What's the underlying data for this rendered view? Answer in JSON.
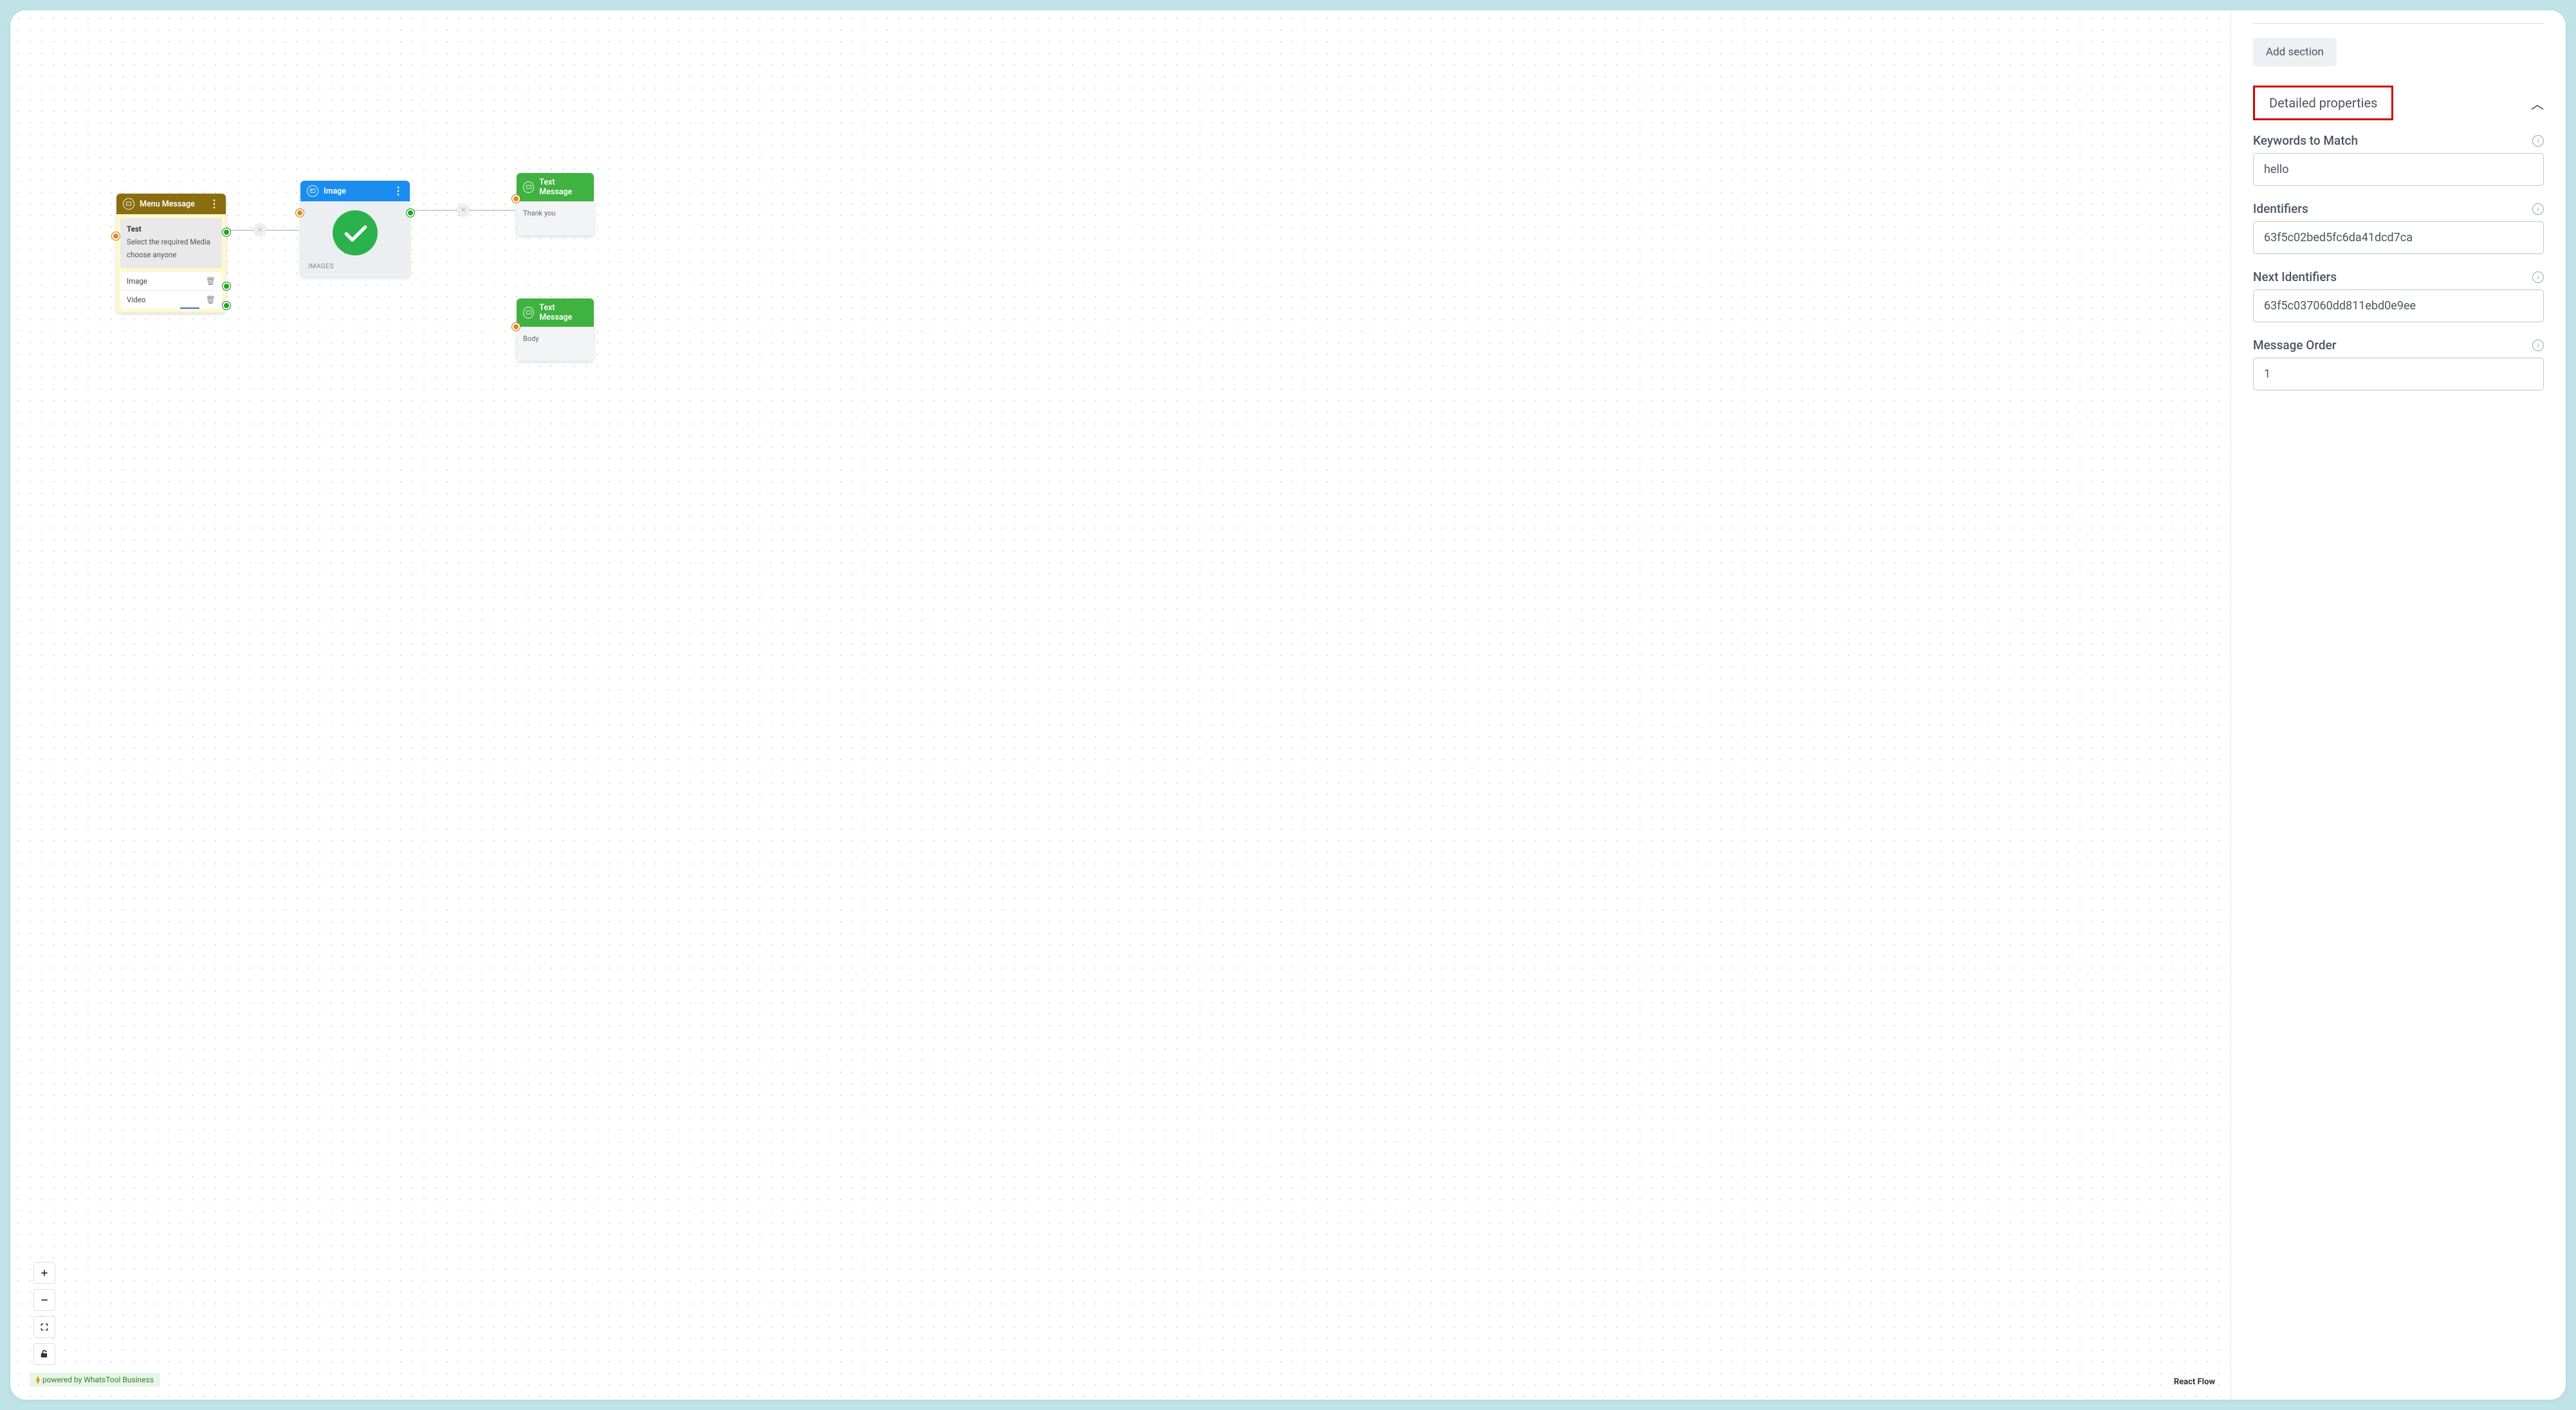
{
  "canvas": {
    "nodes": {
      "menu": {
        "title": "Menu Message",
        "body_title": "Test",
        "body_line1": "Select the required Media",
        "body_line2": "choose anyone",
        "options": [
          "Image",
          "Video"
        ]
      },
      "image": {
        "title": "Image",
        "caption": "IMAGES"
      },
      "text1": {
        "title": "Text Message",
        "body": "Thank you"
      },
      "text2": {
        "title": "Text Message",
        "body": "Body"
      }
    },
    "powered_by": "powered by WhatsTool Business",
    "react_flow": "React Flow"
  },
  "panel": {
    "add_section": "Add section",
    "detailed_properties": "Detailed properties",
    "fields": {
      "keywords": {
        "label": "Keywords to Match",
        "value": "hello"
      },
      "identifiers": {
        "label": "Identifiers",
        "value": "63f5c02bed5fc6da41dcd7ca"
      },
      "next_identifiers": {
        "label": "Next Identifiers",
        "value": "63f5c037060dd811ebd0e9ee"
      },
      "message_order": {
        "label": "Message Order",
        "value": "1"
      }
    }
  }
}
